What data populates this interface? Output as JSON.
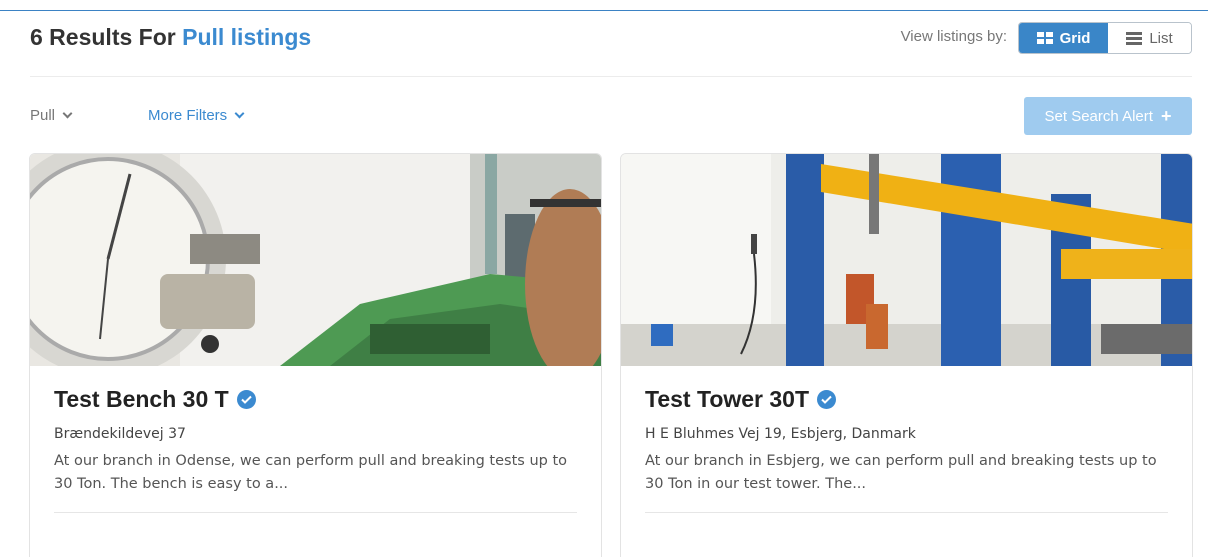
{
  "header": {
    "results_count": "6 Results For",
    "query": "Pull listings",
    "view_label": "View listings by:",
    "view_options": [
      {
        "label": "Grid",
        "icon": "grid-icon",
        "selected": true
      },
      {
        "label": "List",
        "icon": "list-icon",
        "selected": false
      }
    ]
  },
  "filters": {
    "pull_label": "Pull",
    "more_filters_label": "More Filters",
    "set_alert_label": "Set Search Alert",
    "set_alert_icon": "plus-icon"
  },
  "colors": {
    "accent": "#3b8ad0",
    "toggle_active": "#3a86c8",
    "alert_button": "#9fcbef"
  },
  "listings": [
    {
      "title": "Test Bench 30 T",
      "verified": true,
      "address": "Brændekildevej 37",
      "description": "At our branch in Odense, we can perform pull and breaking tests up to 30 Ton. The bench is easy to a...",
      "image": "test-bench-photo"
    },
    {
      "title": "Test Tower 30T",
      "verified": true,
      "address": "H E Bluhmes Vej 19, Esbjerg, Danmark",
      "description": "At our branch in Esbjerg, we can perform pull and breaking tests up to 30 Ton in our test tower. The...",
      "image": "test-tower-photo"
    }
  ]
}
